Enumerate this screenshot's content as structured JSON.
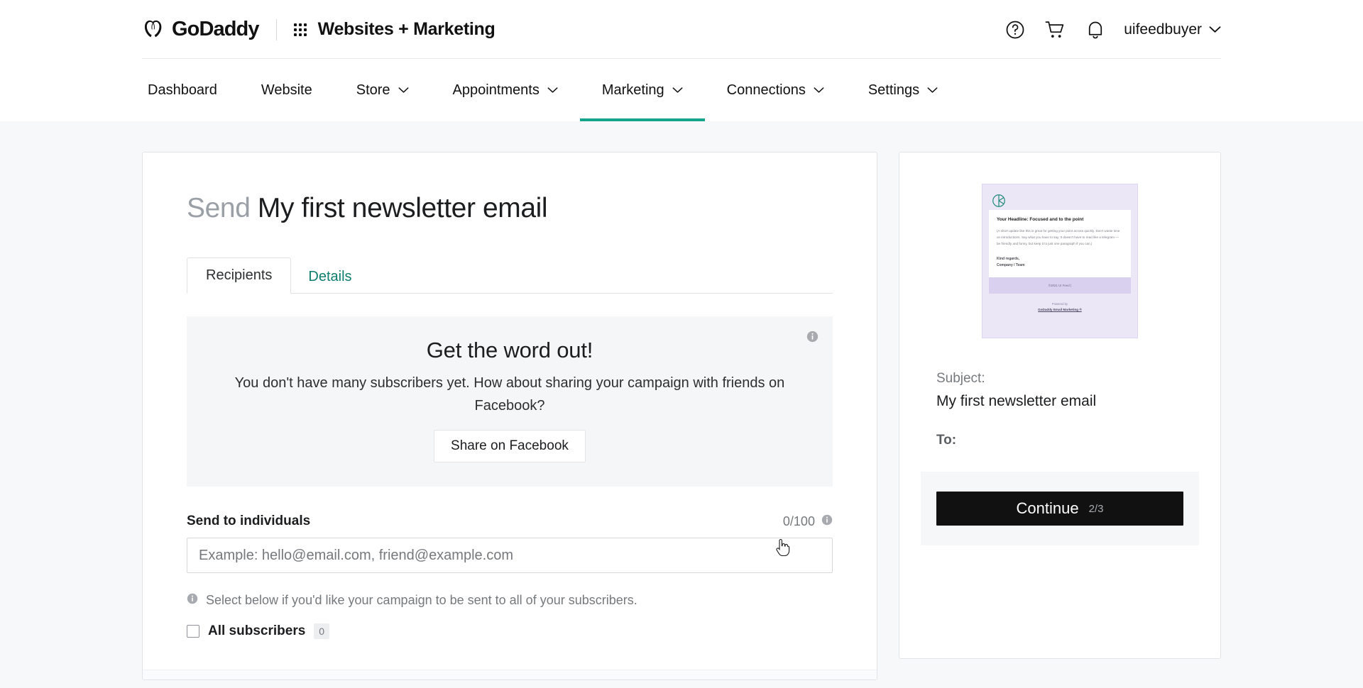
{
  "topbar": {
    "brand": "GoDaddy",
    "brand_tm": "™",
    "product": "Websites + Marketing",
    "account_name": "uifeedbuyer",
    "icons": {
      "waffle": "app-grid-icon",
      "help": "help-circle-icon",
      "cart": "shopping-cart-icon",
      "bell": "notification-bell-icon",
      "chevron": "chevron-down-icon"
    }
  },
  "nav": {
    "items": [
      {
        "label": "Dashboard",
        "has_caret": false,
        "active": false
      },
      {
        "label": "Website",
        "has_caret": false,
        "active": false
      },
      {
        "label": "Store",
        "has_caret": true,
        "active": false
      },
      {
        "label": "Appointments",
        "has_caret": true,
        "active": false
      },
      {
        "label": "Marketing",
        "has_caret": true,
        "active": true
      },
      {
        "label": "Connections",
        "has_caret": true,
        "active": false
      },
      {
        "label": "Settings",
        "has_caret": true,
        "active": false
      }
    ],
    "active_color": "#14a38b"
  },
  "main": {
    "title_prefix": "Send",
    "title_name": "My first newsletter email",
    "tabs": [
      {
        "label": "Recipients",
        "active": true
      },
      {
        "label": "Details",
        "active": false
      }
    ],
    "promo": {
      "title": "Get the word out!",
      "subtitle": "You don't have many subscribers yet. How about sharing your campaign with friends on Facebook?",
      "button_label": "Share on Facebook",
      "info_icon": "info-icon"
    },
    "send_field": {
      "label": "Send to individuals",
      "counter": "0/100",
      "counter_info_icon": "info-icon",
      "placeholder": "Example: hello@email.com, friend@example.com",
      "value": ""
    },
    "hint": {
      "icon": "info-icon",
      "text": "Select below if you'd like your campaign to be sent to all of your subscribers."
    },
    "all_subscribers": {
      "label": "All subscribers",
      "count": "0",
      "checked": false
    }
  },
  "preview": {
    "thumbnail": {
      "logo_icon": "circle-brand-logo-icon",
      "headline": "Your Headline: Focused and to the point",
      "body": "(A short update like this is great for getting your point across quickly. Don't waste time on introductions. Say what you have to say. It doesn't have to read like a telegram — be friendly and funny, but keep it to just one paragraph if you can.)",
      "signoff_1": "Kind regards,",
      "signoff_2": "Company / Team",
      "footer_bar": "©2021 UI Feed |",
      "powered_by": "Powered by",
      "powered_link": "GoDaddy Email Marketing ®"
    },
    "subject_label": "Subject:",
    "subject_value": "My first newsletter email",
    "to_label": "To:",
    "continue_label": "Continue",
    "continue_step": "2/3"
  }
}
